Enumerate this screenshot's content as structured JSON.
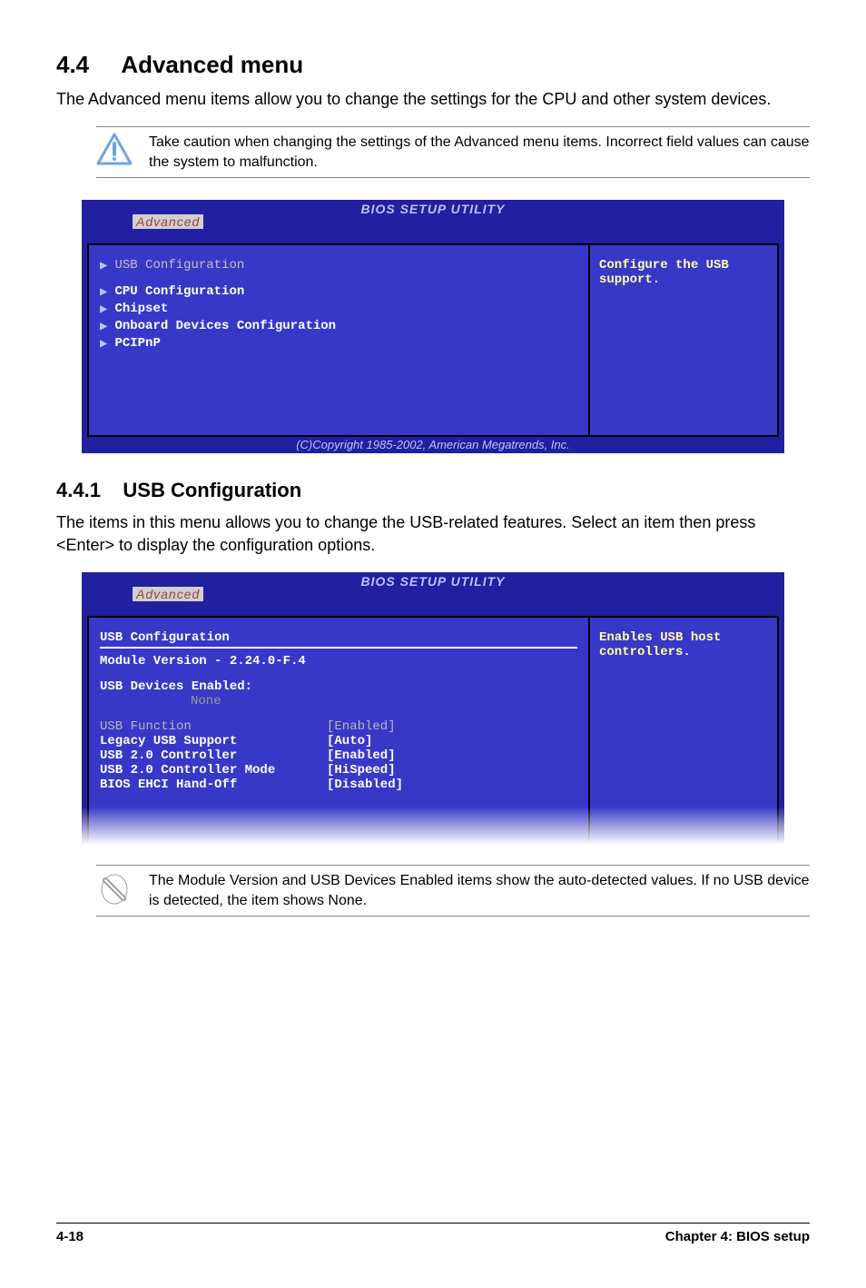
{
  "section": {
    "number": "4.4",
    "title": "Advanced menu",
    "intro": "The Advanced menu items allow you to change the settings for the CPU and other system devices."
  },
  "caution": "Take caution when changing the settings of the Advanced menu items. Incorrect field values can cause the system to malfunction.",
  "bios1": {
    "header": "BIOS SETUP UTILITY",
    "tab": "Advanced",
    "selected": "USB Configuration",
    "items": [
      "CPU Configuration",
      "Chipset",
      "Onboard Devices Configuration",
      "PCIPnP"
    ],
    "help": "Configure the USB support.",
    "footer": "(C)Copyright 1985-2002, American Megatrends, Inc."
  },
  "sub441": {
    "number": "4.4.1",
    "title": "USB Configuration",
    "intro": "The items in this menu allows you to change the USB-related features. Select an item then press <Enter> to display the configuration options."
  },
  "bios2": {
    "header": "BIOS SETUP UTILITY",
    "tab": "Advanced",
    "title": "USB Configuration",
    "module": "Module Version - 2.24.0-F.4",
    "devlabel": "USB Devices Enabled:",
    "devnone": "None",
    "rows": [
      {
        "label": "USB Function",
        "value": "[Enabled]",
        "grey": true
      },
      {
        "label": "Legacy USB Support",
        "value": "[Auto]"
      },
      {
        "label": "USB 2.0 Controller",
        "value": "[Enabled]"
      },
      {
        "label": "USB 2.0 Controller Mode",
        "value": "[HiSpeed]"
      },
      {
        "label": "BIOS EHCI Hand-Off",
        "value": "[Disabled]"
      }
    ],
    "help": "Enables USB host controllers."
  },
  "note": "The Module Version and USB Devices Enabled items show the auto-detected values. If no USB device is detected, the item shows None.",
  "footer": {
    "left": "4-18",
    "right": "Chapter 4: BIOS setup"
  }
}
